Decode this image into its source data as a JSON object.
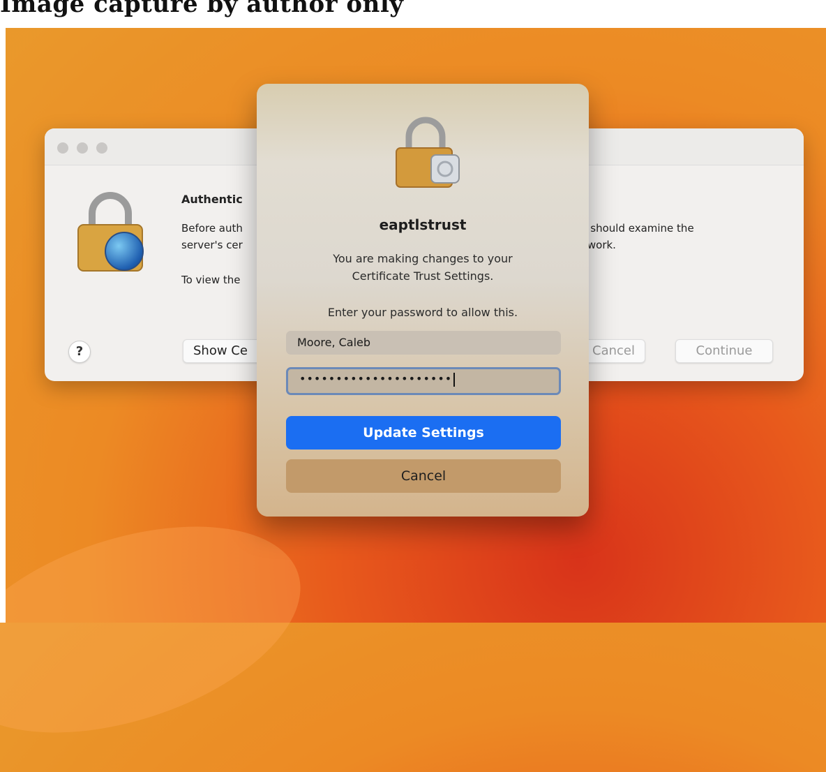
{
  "top_caption": "Image capture by author only",
  "background_window": {
    "title": "Authentic",
    "line1_left": "Before auth",
    "line1_right": "u should examine the",
    "line2_left": "server's cer",
    "line2_right": "twork.",
    "line3_left": "To view the",
    "help_label": "?",
    "show_button": "Show Ce",
    "cancel_button": "Cancel",
    "continue_button": "Continue"
  },
  "dialog": {
    "title": "eaptlstrust",
    "message": "You are making changes to your Certificate Trust Settings.",
    "prompt": "Enter your password to allow this.",
    "username_value": "Moore, Caleb",
    "password_value": "•••••••••••••••••••••",
    "primary_button": "Update Settings",
    "secondary_button": "Cancel"
  },
  "icons": {
    "lock": "lock-icon",
    "globe": "globe-icon",
    "badge": "gear-badge-icon"
  },
  "colors": {
    "accent": "#1b6ef2",
    "focus_ring": "#6b89b8"
  }
}
